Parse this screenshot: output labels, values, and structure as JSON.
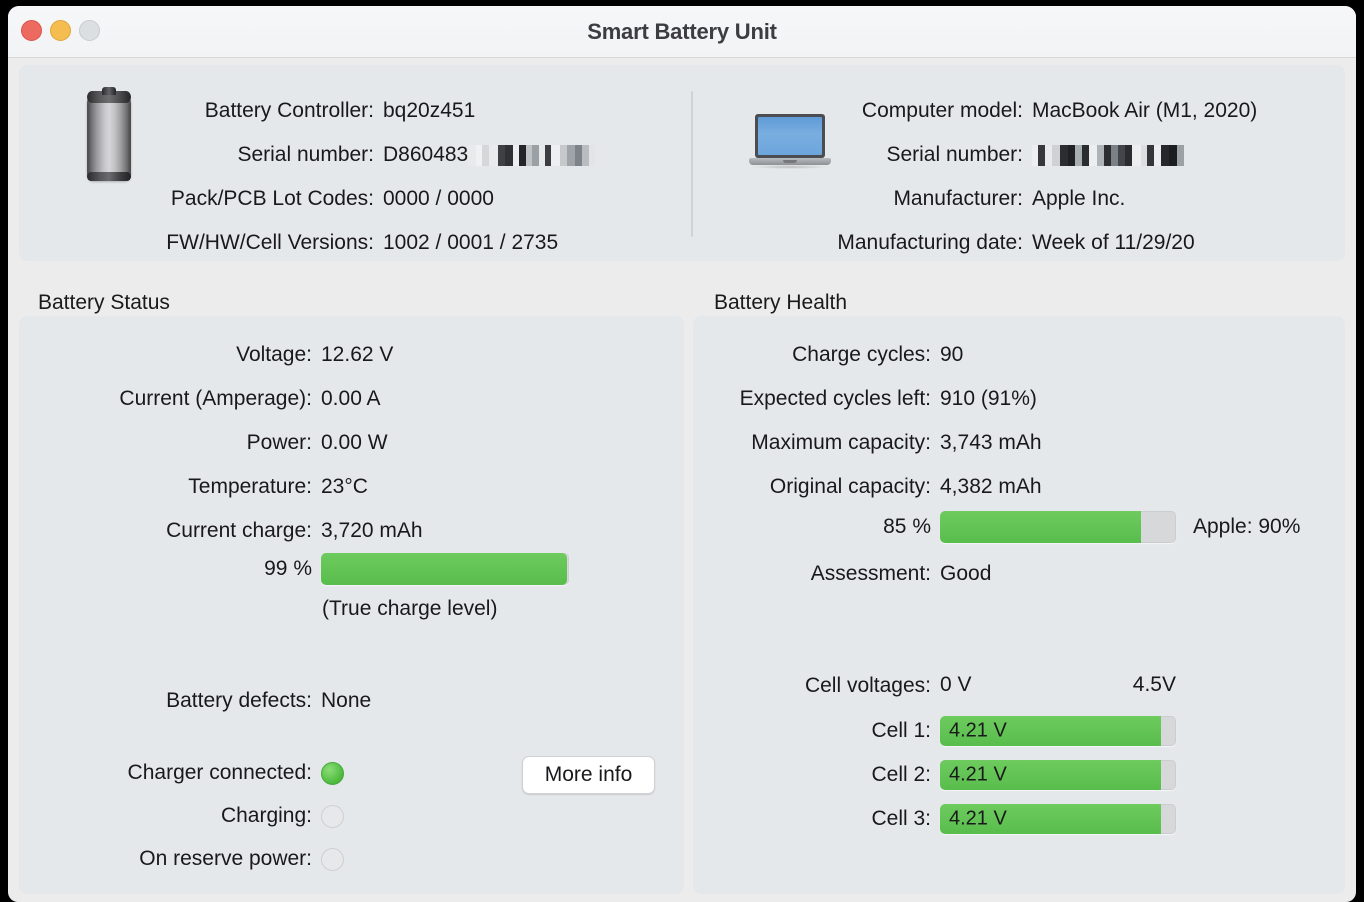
{
  "window": {
    "title": "Smart Battery Unit",
    "controls": {
      "close": "close-button",
      "minimize": "minimize-button",
      "zoom": "zoom-button"
    }
  },
  "colors": {
    "accent_green": "#62c554",
    "bar_track": "#d6d8da",
    "panel_bg": "#e5e8ea",
    "window_bg": "#ececec",
    "close_red": "#ec6a5f",
    "minimize_yellow": "#f5bd4f",
    "zoom_gray": "#dcdfe1"
  },
  "battery_info": {
    "icon": "battery-cylinder-icon",
    "rows": [
      {
        "label": "Battery Controller:",
        "value": "bq20z451"
      },
      {
        "label": "Serial number:",
        "value": "D860483",
        "redacted": true
      },
      {
        "label": "Pack/PCB Lot Codes:",
        "value": "0000 / 0000"
      },
      {
        "label": "FW/HW/Cell Versions:",
        "value": "1002 / 0001 / 2735"
      }
    ]
  },
  "computer_info": {
    "icon": "laptop-icon",
    "rows": [
      {
        "label": "Computer model:",
        "value": "MacBook Air (M1, 2020)"
      },
      {
        "label": "Serial number:",
        "value": "",
        "redacted": true
      },
      {
        "label": "Manufacturer:",
        "value": "Apple Inc."
      },
      {
        "label": "Manufacturing date:",
        "value": "Week of 11/29/20"
      }
    ]
  },
  "battery_status": {
    "section_title": "Battery Status",
    "rows": [
      {
        "label": "Voltage:",
        "value": "12.62 V"
      },
      {
        "label": "Current (Amperage):",
        "value": "0.00 A"
      },
      {
        "label": "Power:",
        "value": "0.00 W"
      },
      {
        "label": "Temperature:",
        "value": "23°C"
      },
      {
        "label": "Current charge:",
        "value": "3,720 mAh"
      }
    ],
    "charge_bar": {
      "label": "99 %",
      "percent": 99,
      "note": "(True charge level)"
    },
    "defects": {
      "label": "Battery defects:",
      "value": "None"
    },
    "indicators": [
      {
        "label": "Charger connected:",
        "state": "on"
      },
      {
        "label": "Charging:",
        "state": "off"
      },
      {
        "label": "On reserve power:",
        "state": "off"
      }
    ],
    "more_info_button": "More info"
  },
  "battery_health": {
    "section_title": "Battery Health",
    "rows": [
      {
        "label": "Charge cycles:",
        "value": "90"
      },
      {
        "label": "Expected cycles left:",
        "value": "910 (91%)"
      },
      {
        "label": "Maximum capacity:",
        "value": "3,743 mAh"
      },
      {
        "label": "Original capacity:",
        "value": "4,382 mAh"
      }
    ],
    "health_bar": {
      "label": "85 %",
      "percent": 85,
      "apple_label": "Apple: 90%"
    },
    "assessment": {
      "label": "Assessment:",
      "value": "Good"
    },
    "cell_voltages": {
      "label": "Cell voltages:",
      "scale_min": "0 V",
      "scale_max": "4.5V",
      "max_value": 4.5,
      "cells": [
        {
          "label": "Cell 1:",
          "value": "4.21 V",
          "volts": 4.21
        },
        {
          "label": "Cell 2:",
          "value": "4.21 V",
          "volts": 4.21
        },
        {
          "label": "Cell 3:",
          "value": "4.21 V",
          "volts": 4.21
        }
      ]
    }
  }
}
